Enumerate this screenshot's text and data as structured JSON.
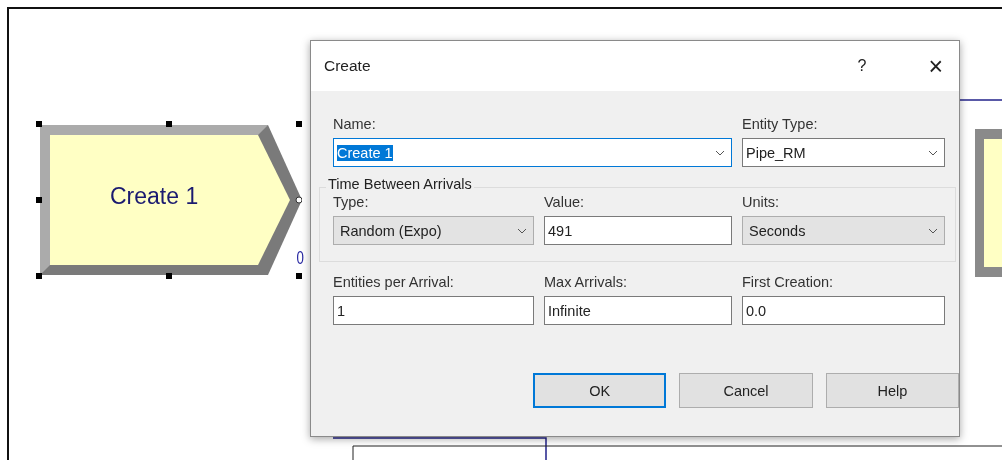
{
  "canvas": {
    "modules": [
      {
        "label": "Create 1",
        "selected": true,
        "counter": "0"
      }
    ]
  },
  "dialog": {
    "title": "Create",
    "help_button": "?",
    "close_button": "×",
    "top_fields": [
      {
        "label": "Name:",
        "value": "Create 1",
        "kind": "combo",
        "focused": true,
        "text_selected": true
      },
      {
        "label": "Entity Type:",
        "value": "Pipe_RM",
        "kind": "combo",
        "focused": false,
        "text_selected": false
      }
    ],
    "group": {
      "title": "Time Between Arrivals",
      "fields": [
        {
          "label": "Type:",
          "value": "Random (Expo)",
          "kind": "select",
          "focused": false,
          "text_selected": false
        },
        {
          "label": "Value:",
          "value": "491",
          "kind": "text",
          "focused": false,
          "text_selected": false
        },
        {
          "label": "Units:",
          "value": "Seconds",
          "kind": "select",
          "focused": false,
          "text_selected": false
        }
      ]
    },
    "bottom_fields": [
      {
        "label": "Entities per Arrival:",
        "value": "1",
        "kind": "text",
        "focused": false,
        "text_selected": false
      },
      {
        "label": "Max Arrivals:",
        "value": "Infinite",
        "kind": "text",
        "focused": false,
        "text_selected": false
      },
      {
        "label": "First Creation:",
        "value": "0.0",
        "kind": "text",
        "focused": false,
        "text_selected": false
      }
    ],
    "buttons": [
      {
        "label": "OK",
        "default": true
      },
      {
        "label": "Cancel",
        "default": false
      },
      {
        "label": "Help",
        "default": false
      }
    ]
  }
}
